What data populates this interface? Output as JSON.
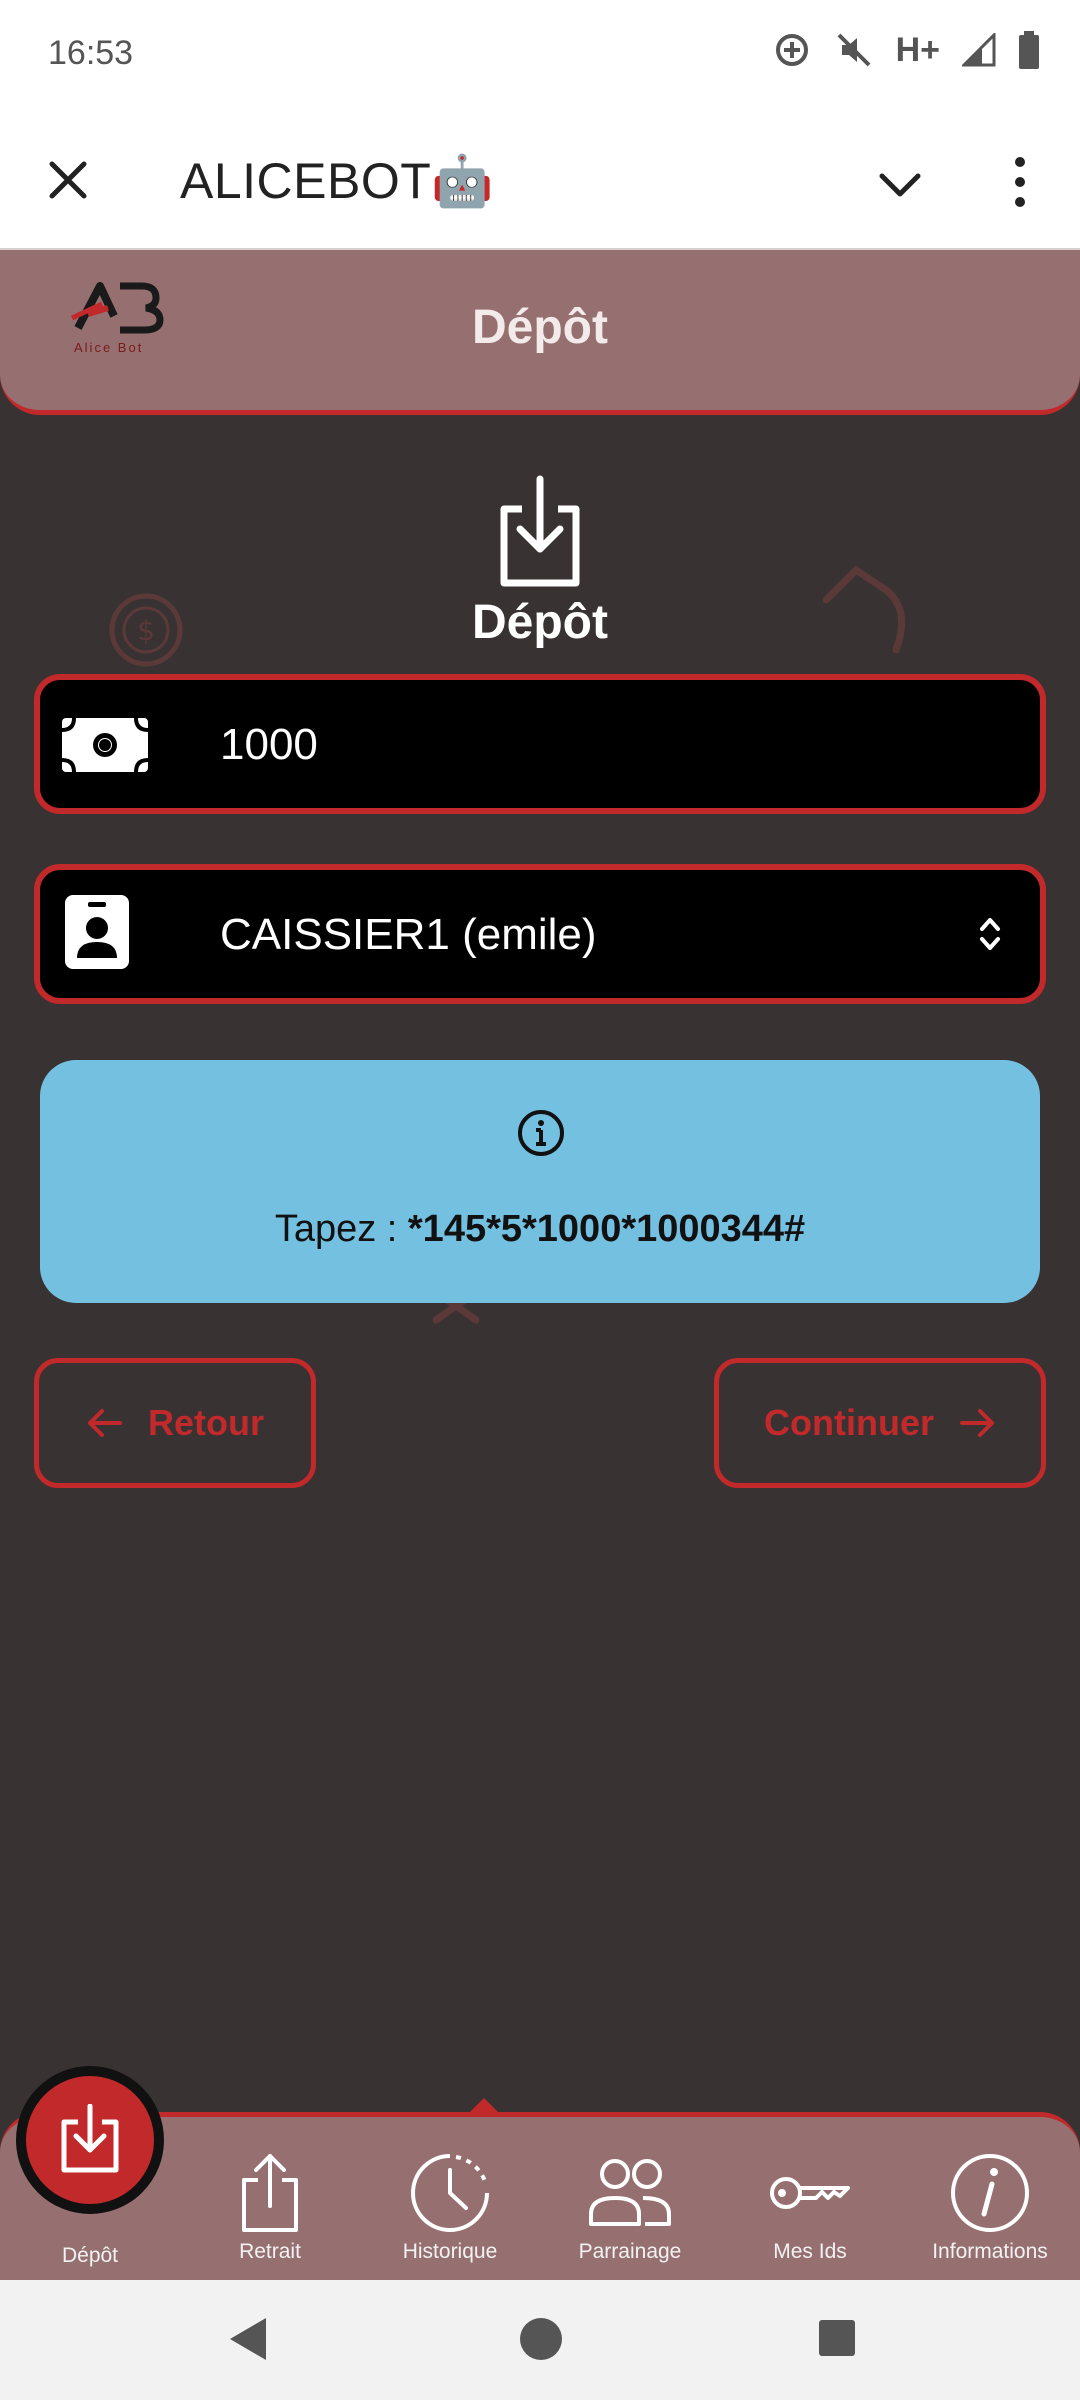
{
  "status_bar": {
    "time": "16:53",
    "network": "H+",
    "icons": [
      "data-saver-icon",
      "mute-icon",
      "signal-icon",
      "battery-icon"
    ]
  },
  "app_bar": {
    "title": "ALICEBOT🤖",
    "icons": [
      "close-icon",
      "chevron-down-icon",
      "more-vert-icon"
    ]
  },
  "header": {
    "logo_text": "Alice Bot",
    "title": "Dépôt"
  },
  "hero": {
    "icon": "download-icon",
    "title": "Dépôt"
  },
  "amount_field": {
    "icon": "cash-icon",
    "value": "1000"
  },
  "cashier_select": {
    "icon": "badge-icon",
    "value": "CAISSIER1 (emile)"
  },
  "info": {
    "icon": "info-icon",
    "prefix": "Tapez : ",
    "code": "*145*5*1000*1000344#"
  },
  "buttons": {
    "back": "Retour",
    "continue": "Continuer"
  },
  "bottom_nav": {
    "items": [
      {
        "label": "Dépôt",
        "icon": "download-icon"
      },
      {
        "label": "Retrait",
        "icon": "upload-icon"
      },
      {
        "label": "Historique",
        "icon": "clock-icon"
      },
      {
        "label": "Parrainage",
        "icon": "people-icon"
      },
      {
        "label": "Mes Ids",
        "icon": "key-icon"
      },
      {
        "label": "Informations",
        "icon": "info-icon"
      }
    ]
  },
  "colors": {
    "accent": "#c2292b",
    "header": "#967070",
    "background": "#383233",
    "info_box": "#74c0e1"
  }
}
